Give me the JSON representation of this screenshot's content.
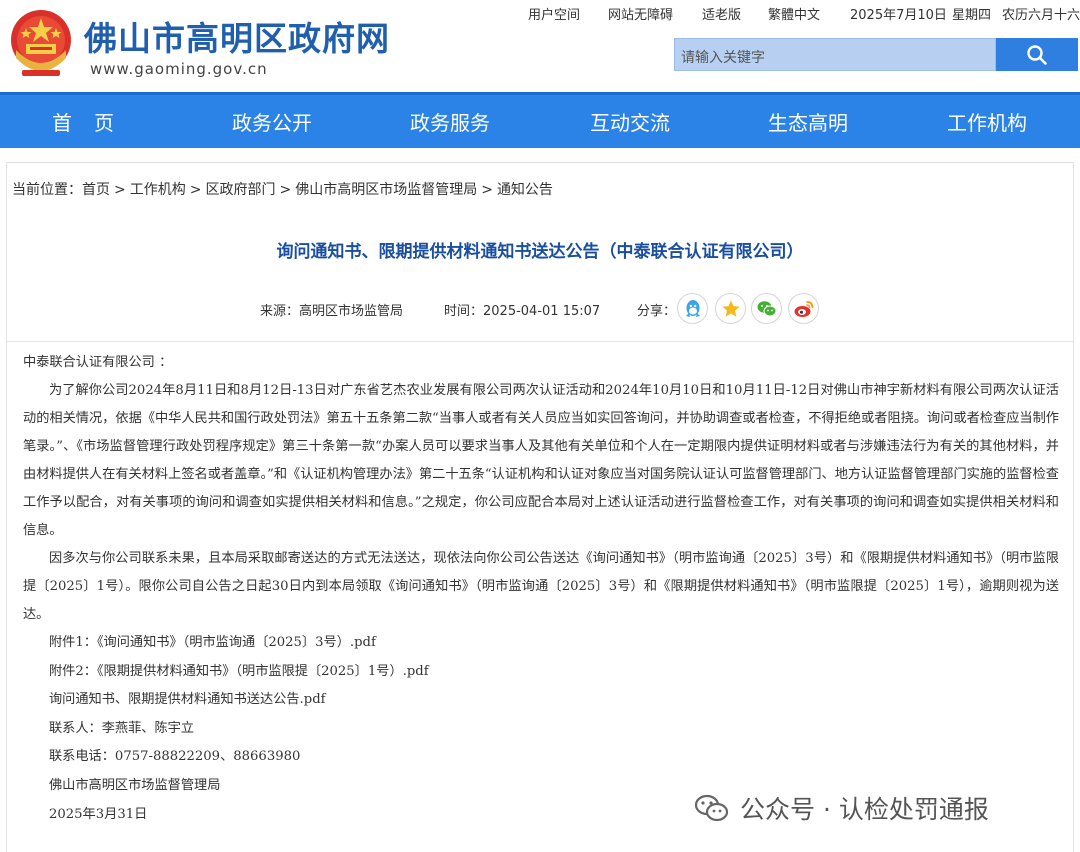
{
  "header": {
    "site_title": "佛山市高明区政府网",
    "site_domain": "www.gaoming.gov.cn",
    "top_links": [
      "用户空间",
      "网站无障碍",
      "适老版",
      "繁體中文"
    ],
    "date": "2025年7月10日",
    "weekday": "星期四",
    "lunar": "农历六月十六",
    "search_placeholder": "请输入关键字",
    "brand_color": "#1f5fae"
  },
  "nav": {
    "items": [
      "首页",
      "政务公开",
      "政务服务",
      "互动交流",
      "生态高明",
      "工作机构"
    ],
    "color": "#2b83e8"
  },
  "breadcrumb": {
    "prefix": "当前位置：",
    "items": [
      "首页",
      "工作机构",
      "区政府部门",
      "佛山市高明区市场监督管理局",
      "通知公告"
    ],
    "separator": ">"
  },
  "article": {
    "title": "询问通知书、限期提供材料通知书送达公告（中泰联合认证有限公司）",
    "source_label": "来源：",
    "source": "高明区市场监管局",
    "time_label": "时间：",
    "time": "2025-04-01 15:07",
    "share_label": "分享：",
    "share_icons": [
      "qq-icon",
      "qzone-icon",
      "wechat-icon",
      "weibo-icon"
    ],
    "salutation": "中泰联合认证有限公司 ：",
    "paragraph1": "为了解你公司2024年8月11日和8月12日-13日对广东省艺杰农业发展有限公司两次认证活动和2024年10月10日和10月11日-12日对佛山市神宇新材料有限公司两次认证活动的相关情况，依据《中华人民共和国行政处罚法》第五十五条第二款“当事人或者有关人员应当如实回答询问，并协助调查或者检查，不得拒绝或者阻挠。询问或者检查应当制作笔录。”、《市场监督管理行政处罚程序规定》第三十条第一款“办案人员可以要求当事人及其他有关单位和个人在一定期限内提供证明材料或者与涉嫌违法行为有关的其他材料，并由材料提供人在有关材料上签名或者盖章。”和《认证机构管理办法》第二十五条“认证机构和认证对象应当对国务院认证认可监督管理部门、地方认证监督管理部门实施的监督检查工作予以配合，对有关事项的询问和调查如实提供相关材料和信息。”之规定，你公司应配合本局对上述认证活动进行监督检查工作，对有关事项的询问和调查如实提供相关材料和信息。",
    "paragraph2": "因多次与你公司联系未果，且本局采取邮寄送达的方式无法送达，现依法向你公司公告送达《询问通知书》（明市监询通〔2025〕3号）和《限期提供材料通知书》（明市监限提〔2025〕1号）。限你公司自公告之日起30日内到本局领取《询问通知书》（明市监询通〔2025〕3号）和《限期提供材料通知书》（明市监限提〔2025〕1号），逾期则视为送达。",
    "attachment1": "附件1：《询问通知书》（明市监询通〔2025〕3号）.pdf",
    "attachment2": "附件2：《限期提供材料通知书》（明市监限提〔2025〕1号）.pdf",
    "attachment3": "询问通知书、限期提供材料通知书送达公告.pdf",
    "contact": "联系人：李燕菲、陈宇立",
    "phone": "联系电话：0757-88822209、88663980",
    "issuer": "佛山市高明区市场监督管理局",
    "issue_date": "2025年3月31日"
  },
  "watermark": {
    "text": "公众号 · 认检处罚通报",
    "icon": "wechat-icon"
  }
}
